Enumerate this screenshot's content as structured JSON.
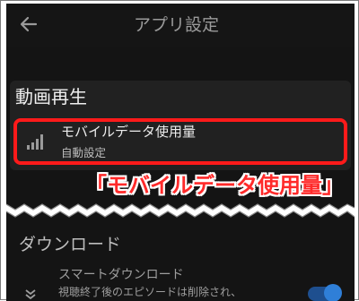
{
  "header": {
    "title": "アプリ設定",
    "back_icon": "arrow-left-icon"
  },
  "playback_section": {
    "title": "動画再生",
    "mobile_data_row": {
      "icon": "signal-bars-icon",
      "label": "モバイルデータ使用量",
      "value": "自動設定"
    }
  },
  "callout": {
    "text": "「モバイルデータ使用量」",
    "color": "#ff2a2a"
  },
  "download_section": {
    "title": "ダウンロード",
    "smart_download_row": {
      "icon": "chevron-down-double-icon",
      "label": "スマートダウンロード",
      "description": "視聴終了後のエピソードは削除され、",
      "toggle_on": true
    }
  },
  "colors": {
    "background": "#141414",
    "highlight": "#ff1a1a",
    "toggle_accent": "#2f7fd8"
  }
}
